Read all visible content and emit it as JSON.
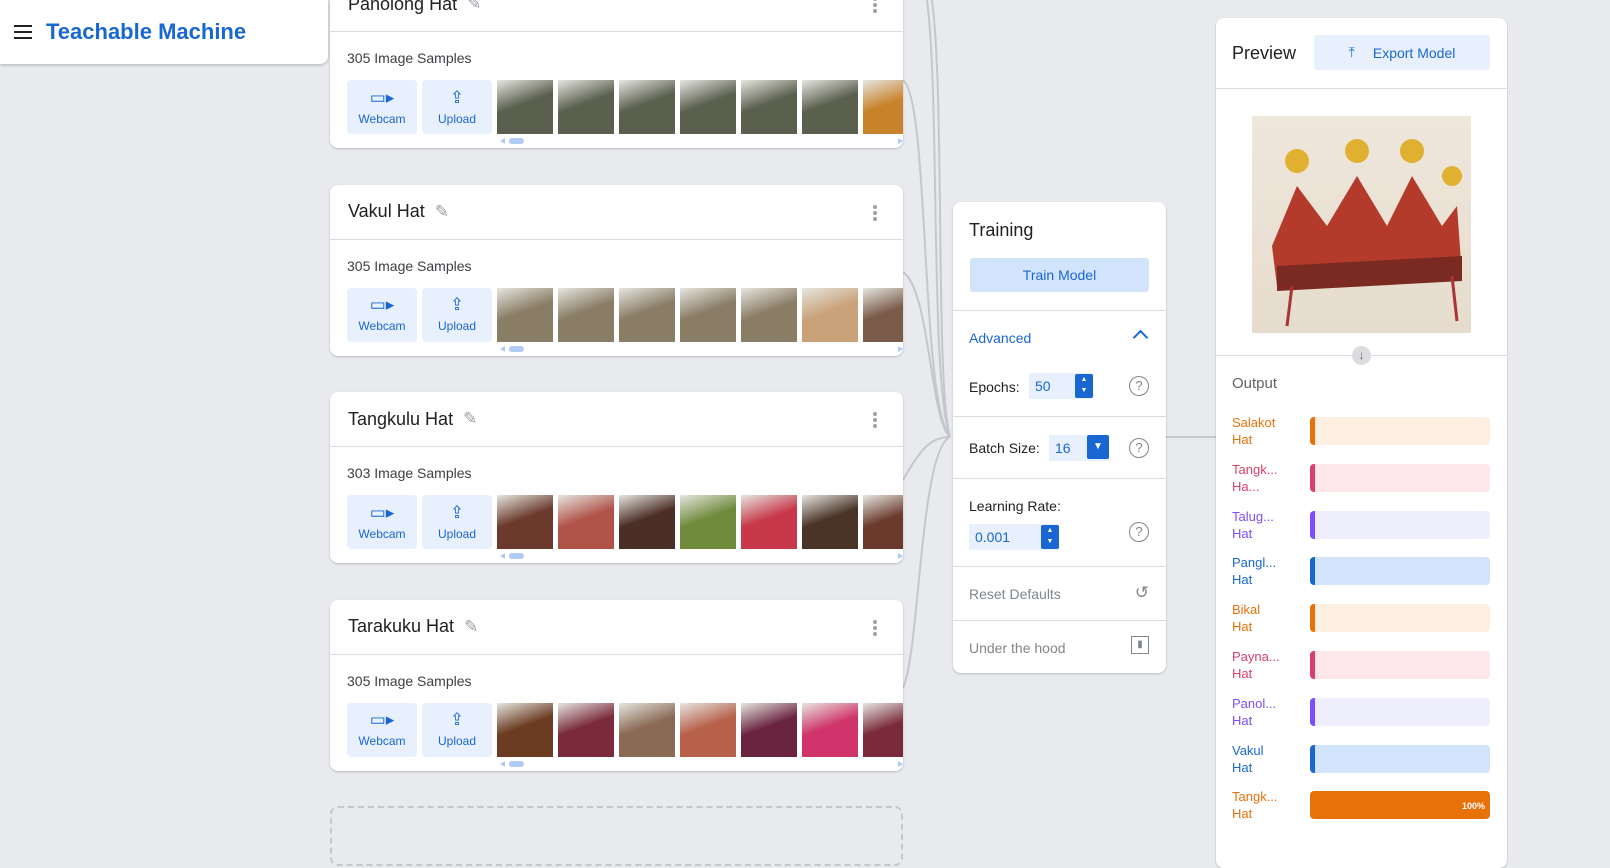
{
  "header": {
    "title": "Teachable Machine"
  },
  "classes": [
    {
      "name": "Panolong Hat",
      "count": "305 Image Samples",
      "thumbs": [
        "#5a5f4e",
        "#5a5f4e",
        "#5a5f4e",
        "#5a5f4e",
        "#5a5f4e",
        "#5a5f4e",
        "#c8822a"
      ]
    },
    {
      "name": "Vakul Hat",
      "count": "305 Image Samples",
      "thumbs": [
        "#8a7d66",
        "#8a7d66",
        "#8a7d66",
        "#8a7d66",
        "#8a7d66",
        "#c9a27a",
        "#7a5a48"
      ]
    },
    {
      "name": "Tangkulu Hat",
      "count": "303 Image Samples",
      "thumbs": [
        "#6b3a2c",
        "#b0544a",
        "#4b2e26",
        "#6f8a3a",
        "#c7394a",
        "#4a3428",
        "#6b3a2c"
      ]
    },
    {
      "name": "Tarakuku Hat",
      "count": "305 Image Samples",
      "thumbs": [
        "#6b3b22",
        "#7a2a3a",
        "#8a6a55",
        "#b7604a",
        "#6b2440",
        "#d0346a",
        "#7a2a3a"
      ]
    }
  ],
  "sample_buttons": {
    "webcam": "Webcam",
    "upload": "Upload"
  },
  "training": {
    "title": "Training",
    "train_button": "Train Model",
    "advanced": "Advanced",
    "epochs_label": "Epochs:",
    "epochs": "50",
    "batch_label": "Batch Size:",
    "batch": "16",
    "lr_label": "Learning Rate:",
    "lr": "0.001",
    "reset": "Reset Defaults",
    "under_hood": "Under the hood"
  },
  "preview": {
    "title": "Preview",
    "export": "Export Model",
    "output_title": "Output",
    "outputs": [
      {
        "label": [
          "Salakot",
          "Hat"
        ],
        "color": "#e8710a",
        "bg": "#feefe3",
        "value": 0
      },
      {
        "label": [
          "Tangk...",
          "Ha..."
        ],
        "color": "#d93f6b",
        "bg": "#fde7ea",
        "value": 0
      },
      {
        "label": [
          "Talug...",
          "Hat"
        ],
        "color": "#7c4dff",
        "bg": "#efeefc",
        "value": 0
      },
      {
        "label": [
          "Pangl...",
          "Hat"
        ],
        "color": "#1967d2",
        "bg": "#d2e3fc",
        "value": 0
      },
      {
        "label": [
          "Bikal",
          "Hat"
        ],
        "color": "#e8710a",
        "bg": "#feefe3",
        "value": 0
      },
      {
        "label": [
          "Payna...",
          "Hat"
        ],
        "color": "#d93f6b",
        "bg": "#fde7ea",
        "value": 0
      },
      {
        "label": [
          "Panol...",
          "Hat"
        ],
        "color": "#7c4dff",
        "bg": "#efeefc",
        "value": 0
      },
      {
        "label": [
          "Vakul",
          "Hat"
        ],
        "color": "#1967d2",
        "bg": "#d2e3fc",
        "value": 0
      },
      {
        "label": [
          "Tangk...",
          "Hat"
        ],
        "color": "#e8710a",
        "bg": "#feefe3",
        "value": 100,
        "value_label": "100%"
      }
    ]
  }
}
